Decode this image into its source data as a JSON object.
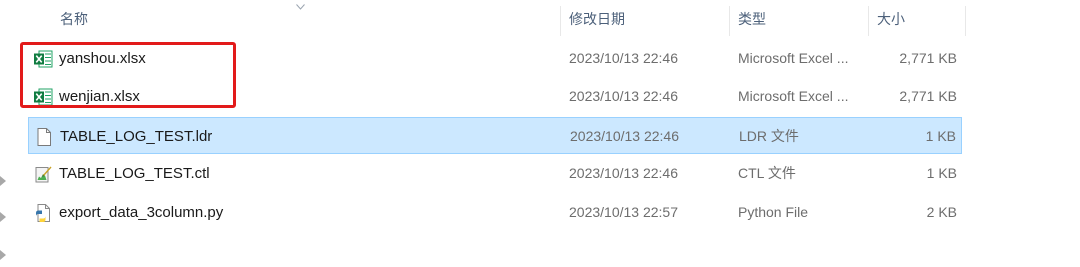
{
  "columns": {
    "name": "名称",
    "date": "修改日期",
    "type": "类型",
    "size": "大小"
  },
  "files": [
    {
      "name": "yanshou.xlsx",
      "date": "2023/10/13 22:46",
      "type": "Microsoft Excel ...",
      "size": "2,771 KB",
      "icon": "excel-file-icon"
    },
    {
      "name": "wenjian.xlsx",
      "date": "2023/10/13 22:46",
      "type": "Microsoft Excel ...",
      "size": "2,771 KB",
      "icon": "excel-file-icon"
    },
    {
      "name": "TABLE_LOG_TEST.ldr",
      "date": "2023/10/13 22:46",
      "type": "LDR 文件",
      "size": "1 KB",
      "icon": "blank-file-icon",
      "selected": true
    },
    {
      "name": "TABLE_LOG_TEST.ctl",
      "date": "2023/10/13 22:46",
      "type": "CTL 文件",
      "size": "1 KB",
      "icon": "ctl-file-icon"
    },
    {
      "name": "export_data_3column.py",
      "date": "2023/10/13 22:57",
      "type": "Python File",
      "size": "2 KB",
      "icon": "python-file-icon"
    }
  ],
  "colors": {
    "selection": "#cce8ff",
    "selection_border": "#99d1ff",
    "annotation": "#e21a1a",
    "header_text": "#4c607a"
  }
}
